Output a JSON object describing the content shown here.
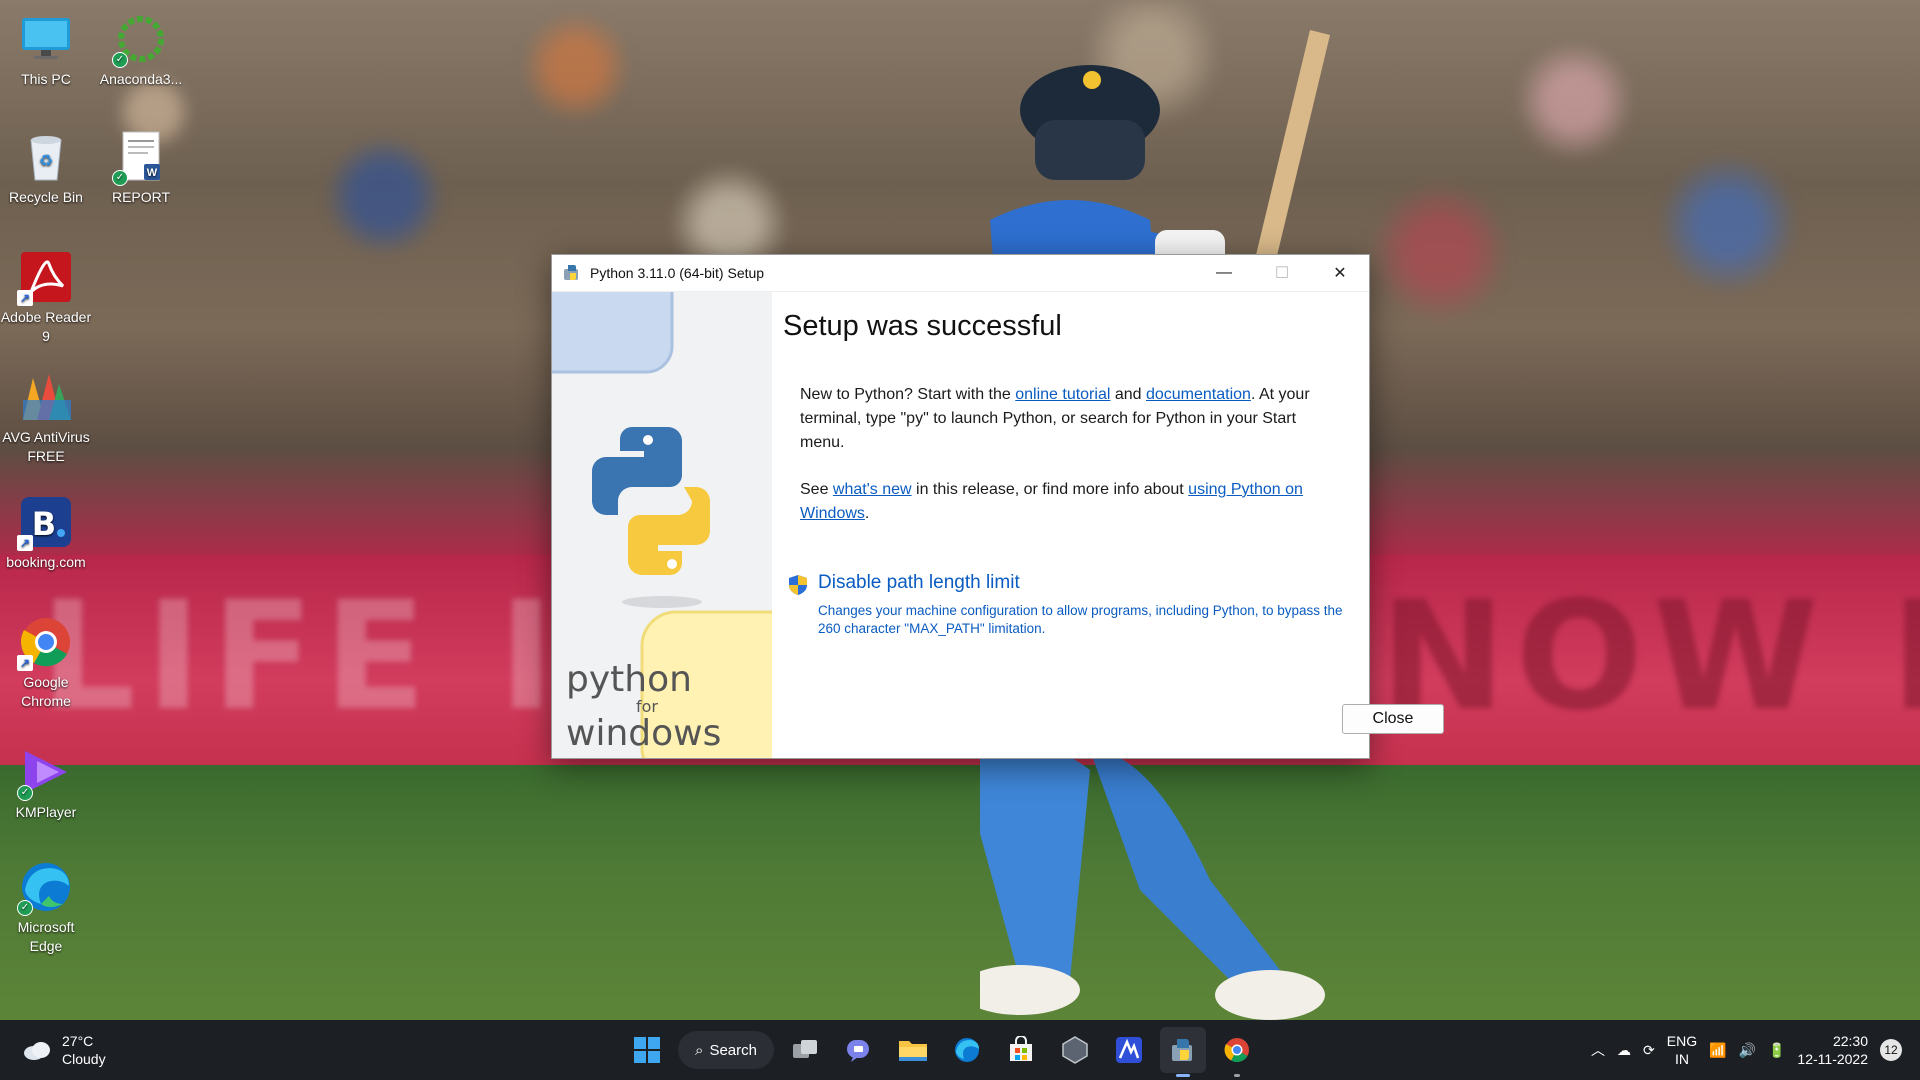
{
  "desktop": {
    "icons": [
      {
        "label": "This PC"
      },
      {
        "label": "Anaconda3..."
      },
      {
        "label": "Recycle Bin"
      },
      {
        "label": "REPORT"
      },
      {
        "label": "Adobe Reader 9"
      },
      {
        "label": "AVG AntiVirus FREE"
      },
      {
        "label": "booking.com"
      },
      {
        "label": "Google Chrome"
      },
      {
        "label": "KMPlayer"
      },
      {
        "label": "Microsoft Edge"
      }
    ]
  },
  "wallpaper": {
    "board_text_left": "LIFE INS",
    "board_text_right": "NOW INV"
  },
  "dialog": {
    "title": "Python 3.11.0 (64-bit) Setup",
    "heading": "Setup was successful",
    "p1_before": "New to Python? Start with the ",
    "p1_link1": "online tutorial",
    "p1_mid": " and ",
    "p1_link2": "documentation",
    "p1_after": ". At your terminal, type \"py\" to launch Python, or search for Python in your Start menu.",
    "p2_before": "See ",
    "p2_link1": "what's new",
    "p2_mid": " in this release, or find more info about ",
    "p2_link2": "using Python on Windows",
    "p2_after": ".",
    "option_title": "Disable path length limit",
    "option_desc": "Changes your machine configuration to allow programs, including Python, to bypass the 260 character \"MAX_PATH\" limitation.",
    "close_label": "Close",
    "sidebar_brand_1": "python",
    "sidebar_brand_2": "for",
    "sidebar_brand_3": "windows"
  },
  "taskbar": {
    "temperature": "27°C",
    "condition": "Cloudy",
    "search_label": "Search",
    "apps": [
      "start-icon",
      "task-view-icon",
      "teams-chat-icon",
      "file-explorer-icon",
      "edge-icon",
      "microsoft-store-icon",
      "app-icon",
      "app-icon-2",
      "python-setup-icon",
      "chrome-icon"
    ],
    "lang_1": "ENG",
    "lang_2": "IN",
    "time": "22:30",
    "date": "12-11-2022",
    "notification_count": "12"
  }
}
